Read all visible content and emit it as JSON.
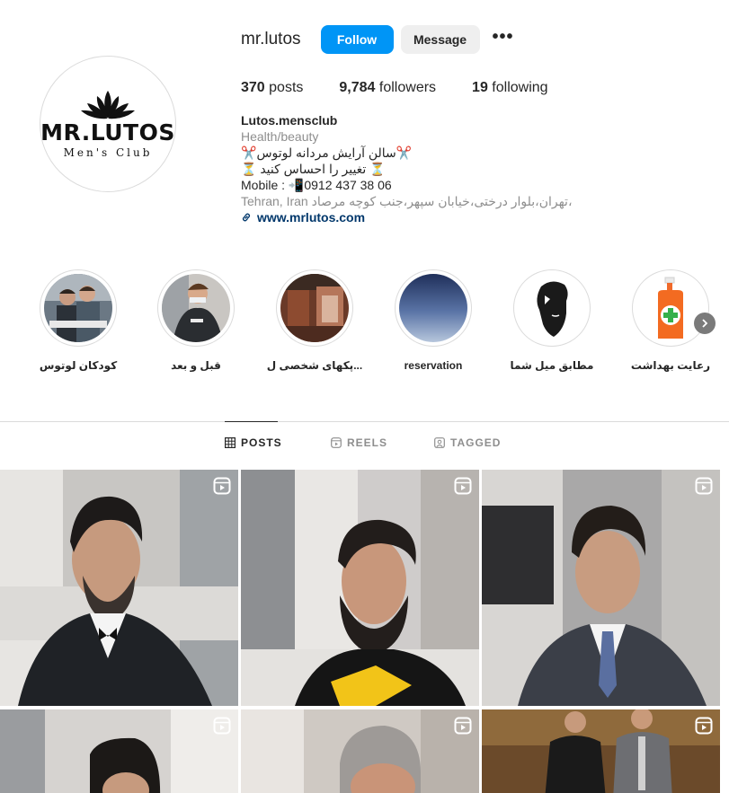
{
  "profile": {
    "username": "mr.lutos",
    "follow_label": "Follow",
    "message_label": "Message",
    "more_label": "•••",
    "logo": {
      "main": "MR.LUTOS",
      "sub": "Men's Club"
    }
  },
  "stats": {
    "posts": {
      "value": "370",
      "label": "posts"
    },
    "followers": {
      "value": "9,784",
      "label": "followers"
    },
    "following": {
      "value": "19",
      "label": "following"
    }
  },
  "bio": {
    "name": "Lutos.mensclub",
    "category": "Health/beauty",
    "line1": "✂️سالن آرایش مردانه لوتوس✂️",
    "line2": "⏳ تغییر را احساس کنید ⏳",
    "line3": "Mobile : 📲0912 437 38 06",
    "address": "Tehran, Iran تهران،بلوار درختی،خیابان سپهر،جنب کوچه مرصاد،",
    "link": "www.mrlutos.com"
  },
  "highlights": [
    {
      "label": "کودکان لوتوس",
      "icon": "kids-photo"
    },
    {
      "label": "قبل و بعد",
      "icon": "before-after-photo"
    },
    {
      "label": "پکهای شخصی ل...",
      "icon": "interior-photo"
    },
    {
      "label": "reservation",
      "icon": "sky-photo"
    },
    {
      "label": "مطابق میل شما",
      "icon": "beard-man-illustration"
    },
    {
      "label": "رعایت بهداشت",
      "icon": "sanitizer-bottle-illustration"
    }
  ],
  "tabs": [
    {
      "label": "POSTS",
      "icon": "grid-icon",
      "active": true
    },
    {
      "label": "REELS",
      "icon": "reels-icon",
      "active": false
    },
    {
      "label": "TAGGED",
      "icon": "tagged-icon",
      "active": false
    }
  ],
  "posts": [
    {
      "type": "reel",
      "subject": "man-in-tuxedo-beard"
    },
    {
      "type": "reel",
      "subject": "man-haircut-black-shirt"
    },
    {
      "type": "reel",
      "subject": "man-in-suit-tie"
    },
    {
      "type": "reel",
      "subject": "man-haircut-fade"
    },
    {
      "type": "reel",
      "subject": "man-grey-hair"
    },
    {
      "type": "reel",
      "subject": "two-men-outdoor"
    }
  ],
  "colors": {
    "accent": "#0095f6",
    "link": "#00376b",
    "muted": "#8e8e8e",
    "border": "#dbdbdb"
  }
}
